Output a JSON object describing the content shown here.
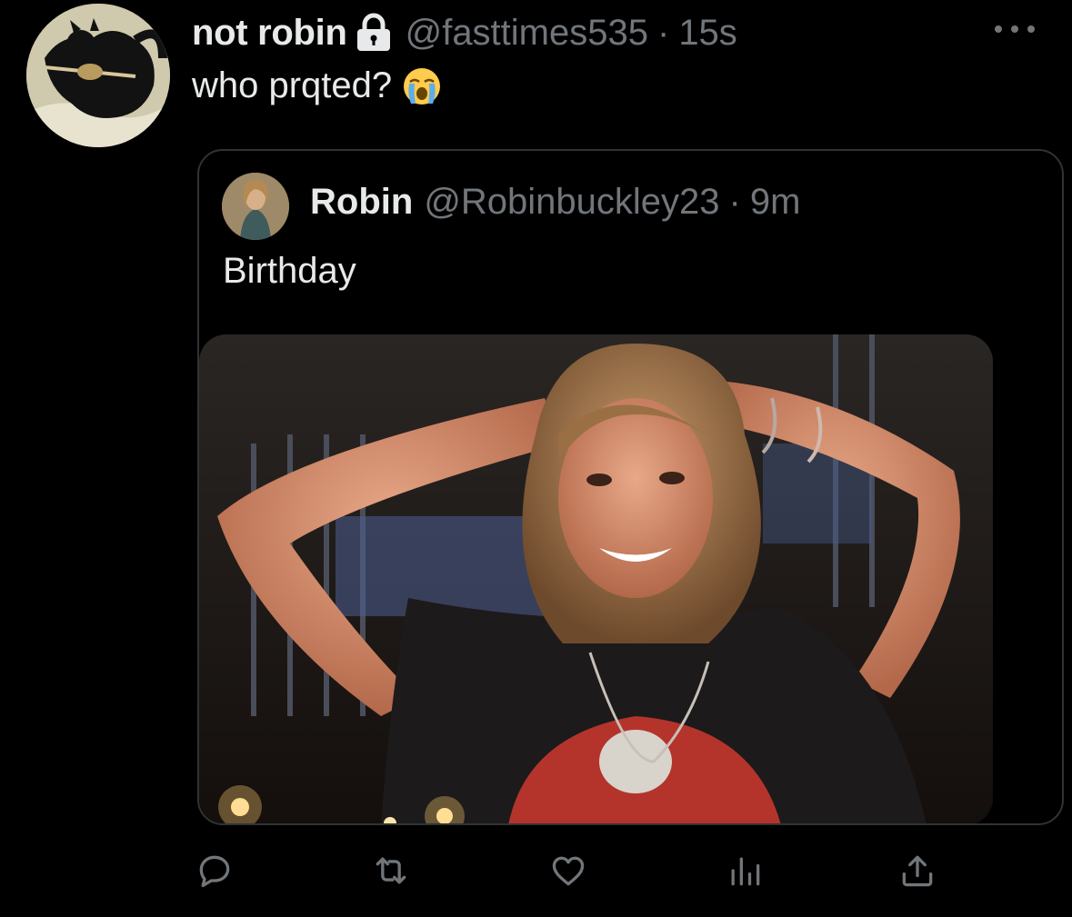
{
  "tweet": {
    "display_name": "not robin",
    "handle": "@fasttimes535",
    "separator": "·",
    "time": "15s",
    "text": "who prqted?",
    "emoji": "loudly-crying-face"
  },
  "quoted_tweet": {
    "display_name": "Robin",
    "handle": "@Robinbuckley23",
    "separator": "·",
    "time": "9m",
    "text": "Birthday"
  },
  "actions": [
    "reply-icon",
    "retweet-icon",
    "like-icon",
    "analytics-icon",
    "share-icon"
  ],
  "colors": {
    "background": "#000000",
    "primary_text": "#e7e9ea",
    "secondary_text": "#71767b",
    "border": "#2f3336"
  }
}
